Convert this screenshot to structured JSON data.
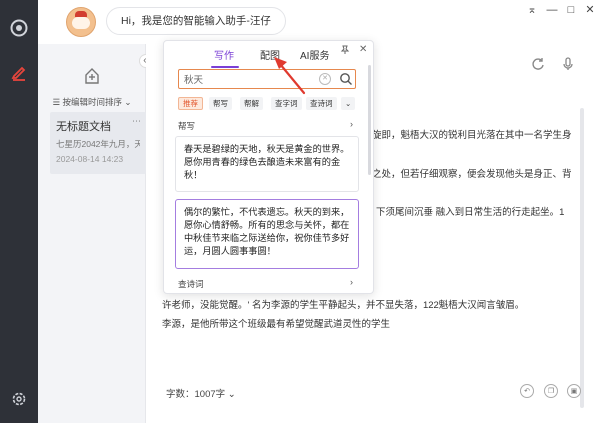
{
  "topbar": {
    "greeting": "Hi，我是您的智能输入助手-汪仔",
    "window": {
      "pin": "⌅",
      "minimize": "—",
      "maximize": "□",
      "close": "✕"
    }
  },
  "doclist": {
    "sort_label": "☰ 按编辑时间排序 ⌄",
    "items": [
      {
        "title": "无标题文档",
        "snippet": "七星历2042年九月，天风...",
        "date": "2024-08-14 14:23",
        "more": "⋯"
      }
    ],
    "collapse": "«"
  },
  "panel": {
    "tabs": [
      {
        "label": "写作",
        "active": true
      },
      {
        "label": "配图",
        "active": false
      },
      {
        "label": "AI服务",
        "active": false
      }
    ],
    "search": {
      "value": "秋天"
    },
    "chips": [
      "推荐",
      "帮写",
      "帮解",
      "查字词",
      "查诗词"
    ],
    "section_help": "帮写",
    "cards": [
      {
        "lines": [
          "春天是碧绿的天地，秋天是黄金的世界。",
          "愿你用青春的绿色去酿造未来富有的金",
          "秋！"
        ]
      },
      {
        "lines": [
          "偶尔的繁忙，不代表遗忘。秋天的到来，",
          "愿你心情舒畅。所有的思念与关怀，都在",
          "中秋佳节来临之际送给你，祝你佳节多好",
          "运，月圆人圆事事圆！"
        ]
      }
    ],
    "section_poem": "查诗词"
  },
  "editor": {
    "lines": [
      "旋即，魁梧大汉的锐利目光落在其中一名学生身",
      "之处，但若仔细观察，便会发现他头是身正、背",
      "下须尾间沉垂 融入到日常生活的行走起坐。1",
      "许老师，没能觉醒。' 名为李源的学生平静起头，并不显失落，122魁梧大汉闻言皱眉。",
      "李源，是他所带这个班级最有希望觉醒武道灵性的学生"
    ],
    "word_count": "字数：1007字 ⌄"
  },
  "colors": {
    "accent_purple": "#7b3fd6",
    "accent_orange": "#e2572e",
    "annotation_red": "#e03a2f"
  }
}
